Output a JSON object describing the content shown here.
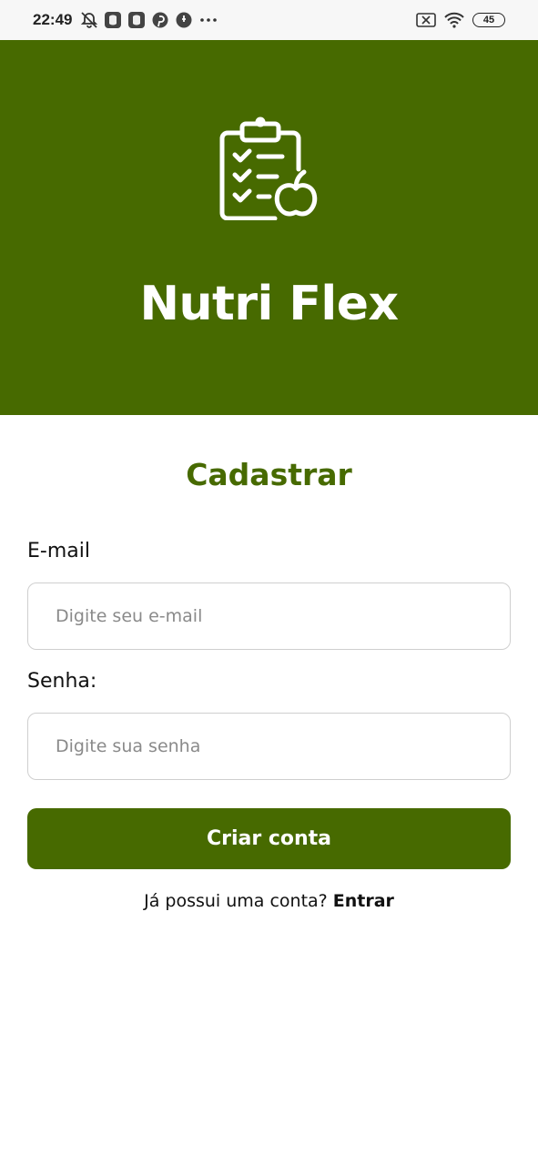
{
  "status_bar": {
    "time": "22:49",
    "battery": "45",
    "left_icons": [
      "alarm-off-icon",
      "app-notification-icon",
      "app-notification-icon",
      "pinterest-icon",
      "touch-icon",
      "more-dots-icon"
    ],
    "right_icons": [
      "sim-off-icon",
      "wifi-icon",
      "battery-icon"
    ]
  },
  "hero": {
    "app_name": "Nutri Flex",
    "logo_icon": "clipboard-checklist-apple-icon",
    "background_color": "#476a00"
  },
  "form": {
    "title": "Cadastrar",
    "email_label": "E-mail",
    "email_placeholder": "Digite seu e-mail",
    "email_value": "",
    "password_label": "Senha:",
    "password_placeholder": "Digite sua senha",
    "password_value": "",
    "submit_label": "Criar conta",
    "login_prompt": "Já possui uma conta?",
    "login_link": "Entrar"
  },
  "colors": {
    "brand": "#476a00",
    "input_border": "#cfcfcf"
  }
}
